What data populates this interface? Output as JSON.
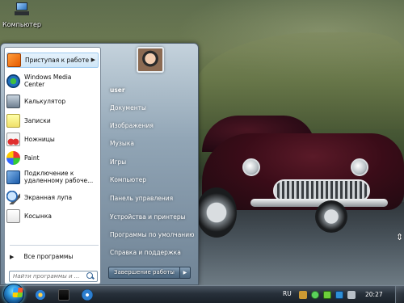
{
  "desktop": {
    "computer_icon_label": "Компьютер"
  },
  "start_menu": {
    "programs": [
      {
        "label": "Приступая к работе",
        "icon": "getting-started-icon",
        "has_submenu": true
      },
      {
        "label": "Windows Media Center",
        "icon": "media-center-icon"
      },
      {
        "label": "Калькулятор",
        "icon": "calculator-icon"
      },
      {
        "label": "Записки",
        "icon": "sticky-notes-icon"
      },
      {
        "label": "Ножницы",
        "icon": "snipping-tool-icon"
      },
      {
        "label": "Paint",
        "icon": "paint-icon"
      },
      {
        "label": "Подключение к удаленному рабоче...",
        "icon": "remote-desktop-icon"
      },
      {
        "label": "Экранная лупа",
        "icon": "magnifier-icon"
      },
      {
        "label": "Косынка",
        "icon": "solitaire-icon"
      }
    ],
    "all_programs": "Все программы",
    "search_placeholder": "Найти программы и ...",
    "right_items": [
      "user",
      "Документы",
      "Изображения",
      "Музыка",
      "Игры",
      "Компьютер",
      "Панель управления",
      "Устройства и принтеры",
      "Программы по умолчанию",
      "Справка и поддержка"
    ],
    "shutdown_label": "Завершение работы"
  },
  "taskbar": {
    "language": "RU",
    "clock": "20:27"
  }
}
